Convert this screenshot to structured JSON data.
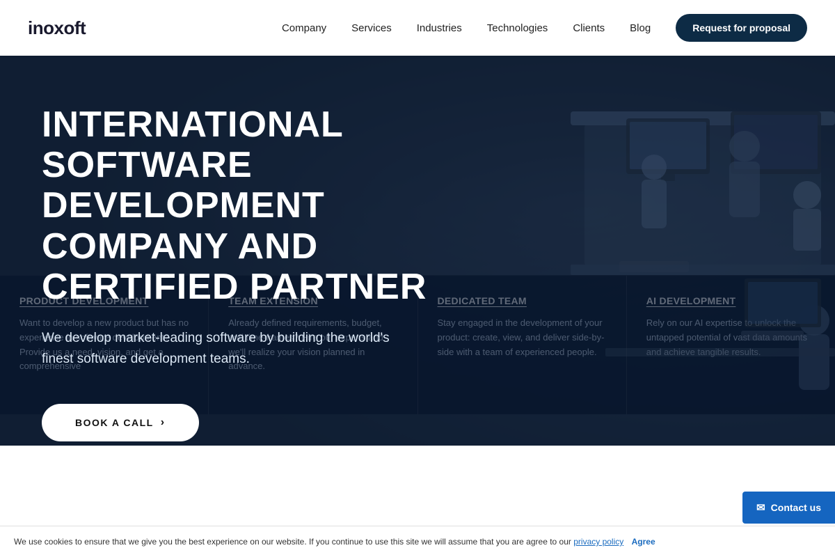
{
  "header": {
    "logo": "inoxoft",
    "nav_links": [
      {
        "label": "Company",
        "id": "company"
      },
      {
        "label": "Services",
        "id": "services"
      },
      {
        "label": "Industries",
        "id": "industries"
      },
      {
        "label": "Technologies",
        "id": "technologies"
      },
      {
        "label": "Clients",
        "id": "clients"
      },
      {
        "label": "Blog",
        "id": "blog"
      }
    ],
    "cta_label": "Request for proposal"
  },
  "hero": {
    "title": "INTERNATIONAL SOFTWARE DEVELOPMENT COMPANY AND CERTIFIED PARTNER",
    "subtitle": "We develop market-leading software by building the world's finest software development teams.",
    "cta_label": "BOOK A CALL",
    "cta_arrow": "›"
  },
  "cards": [
    {
      "title": "PRODUCT DEVELOPMENT",
      "text": "Want to develop a new product but has no experience in software development? Provide us a need, vision, and get a comprehensive"
    },
    {
      "title": "TEAM EXTENSION",
      "text": "Already defined requirements, budget, and time-frames? Hire our experts and we'll realize your vision planned in advance."
    },
    {
      "title": "DEDICATED TEAM",
      "text": "Stay engaged in the development of your product: create, view, and deliver side-by-side with a team of experienced people."
    },
    {
      "title": "AI DEVELOPMENT",
      "text": "Rely on our AI expertise to unlock the untapped potential of vast data amounts and achieve tangible results."
    }
  ],
  "cookie_bar": {
    "text": "We use cookies to ensure that we give you the best experience on our website. If you continue to use this site we will assume that you are agree to our ",
    "link_text": "privacy policy",
    "agree_text": "Agree"
  },
  "contact_float": {
    "label": "Contact us",
    "icon": "✉"
  }
}
